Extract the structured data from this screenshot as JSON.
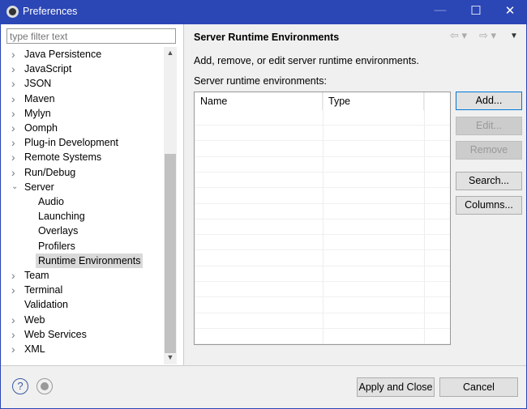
{
  "window": {
    "title": "Preferences",
    "minimize_label": "—",
    "maximize_label": "☐",
    "close_label": "✕"
  },
  "filter": {
    "placeholder": "type filter text"
  },
  "tree": [
    {
      "label": "Java Persistence",
      "expandable": true,
      "level": 0
    },
    {
      "label": "JavaScript",
      "expandable": true,
      "level": 0
    },
    {
      "label": "JSON",
      "expandable": true,
      "level": 0
    },
    {
      "label": "Maven",
      "expandable": true,
      "level": 0
    },
    {
      "label": "Mylyn",
      "expandable": true,
      "level": 0
    },
    {
      "label": "Oomph",
      "expandable": true,
      "level": 0
    },
    {
      "label": "Plug-in Development",
      "expandable": true,
      "level": 0
    },
    {
      "label": "Remote Systems",
      "expandable": true,
      "level": 0
    },
    {
      "label": "Run/Debug",
      "expandable": true,
      "level": 0
    },
    {
      "label": "Server",
      "expandable": true,
      "expanded": true,
      "level": 0
    },
    {
      "label": "Audio",
      "level": 1
    },
    {
      "label": "Launching",
      "level": 1
    },
    {
      "label": "Overlays",
      "level": 1
    },
    {
      "label": "Profilers",
      "level": 1
    },
    {
      "label": "Runtime Environments",
      "level": 1,
      "selected": true
    },
    {
      "label": "Team",
      "expandable": true,
      "level": 0
    },
    {
      "label": "Terminal",
      "expandable": true,
      "level": 0
    },
    {
      "label": "Validation",
      "level": 0
    },
    {
      "label": "Web",
      "expandable": true,
      "level": 0
    },
    {
      "label": "Web Services",
      "expandable": true,
      "level": 0
    },
    {
      "label": "XML",
      "expandable": true,
      "level": 0
    }
  ],
  "page": {
    "title": "Server Runtime Environments",
    "description": "Add, remove, or edit server runtime environments.",
    "list_label": "Server runtime environments:",
    "columns": [
      "Name",
      "Type"
    ],
    "rows": []
  },
  "buttons": {
    "add": "Add...",
    "edit": "Edit...",
    "remove": "Remove",
    "search": "Search...",
    "columns": "Columns..."
  },
  "footer": {
    "help_icon": "?",
    "apply_close": "Apply and Close",
    "cancel": "Cancel"
  },
  "colors": {
    "titlebar": "#2b46b5",
    "selection": "#d9d9d9"
  }
}
